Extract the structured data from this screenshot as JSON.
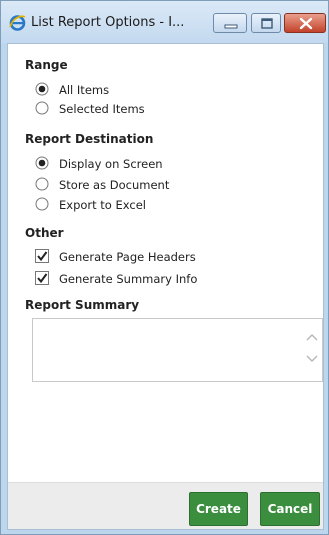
{
  "window": {
    "title": "List Report Options - I..."
  },
  "range": {
    "title": "Range",
    "options": [
      {
        "label": "All Items",
        "checked": true
      },
      {
        "label": "Selected Items",
        "checked": false
      }
    ]
  },
  "destination": {
    "title": "Report Destination",
    "options": [
      {
        "label": "Display on Screen",
        "checked": true
      },
      {
        "label": "Store as Document",
        "checked": false
      },
      {
        "label": "Export to Excel",
        "checked": false
      }
    ]
  },
  "other": {
    "title": "Other",
    "options": [
      {
        "label": "Generate Page Headers",
        "checked": true
      },
      {
        "label": "Generate Summary Info",
        "checked": true
      }
    ]
  },
  "summary": {
    "title": "Report Summary",
    "value": ""
  },
  "footer": {
    "create_label": "Create",
    "cancel_label": "Cancel"
  },
  "colors": {
    "button_green": "#3c8e3f",
    "titlebar": "#c3d9ef",
    "close_red": "#c2432a"
  },
  "icons": {
    "title": "ie-icon",
    "minimize": "minimize-icon",
    "maximize": "maximize-icon",
    "close": "close-icon"
  }
}
